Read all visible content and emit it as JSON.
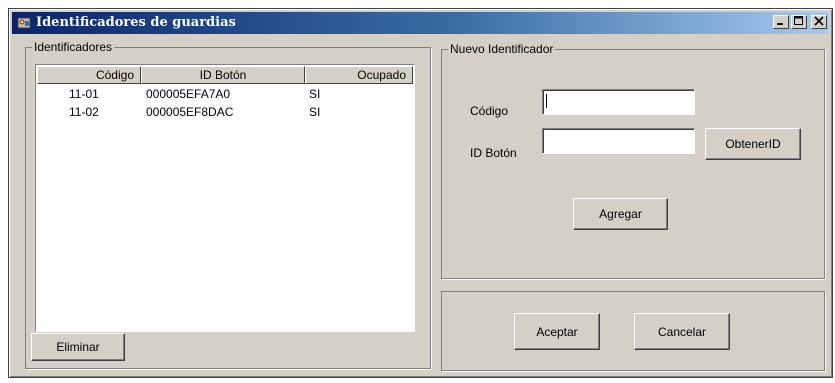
{
  "window": {
    "title": "Identificadores de guardias",
    "icons": {
      "app": "app-icon",
      "minimize": "minimize-icon",
      "maximize": "maximize-icon",
      "close": "close-icon"
    },
    "titlebar_colors": [
      "#0a246a",
      "#3a6ea5",
      "#a6caf0"
    ]
  },
  "identificadores": {
    "group_label": "Identificadores",
    "columns": [
      "Código",
      "ID Botón",
      "Ocupado"
    ],
    "rows": [
      {
        "codigo": "11-01",
        "id_boton": "000005EFA7A0",
        "ocupado": "SI"
      },
      {
        "codigo": "11-02",
        "id_boton": "000005EF8DAC",
        "ocupado": "SI"
      }
    ],
    "delete_button": "Eliminar"
  },
  "nuevo": {
    "group_label": "Nuevo Identificador",
    "codigo_label": "Código",
    "codigo_value": "",
    "id_boton_label": "ID Botón",
    "id_boton_value": "",
    "obtener_button": "ObtenerID",
    "agregar_button": "Agregar"
  },
  "footer": {
    "accept_button": "Aceptar",
    "cancel_button": "Cancelar"
  }
}
